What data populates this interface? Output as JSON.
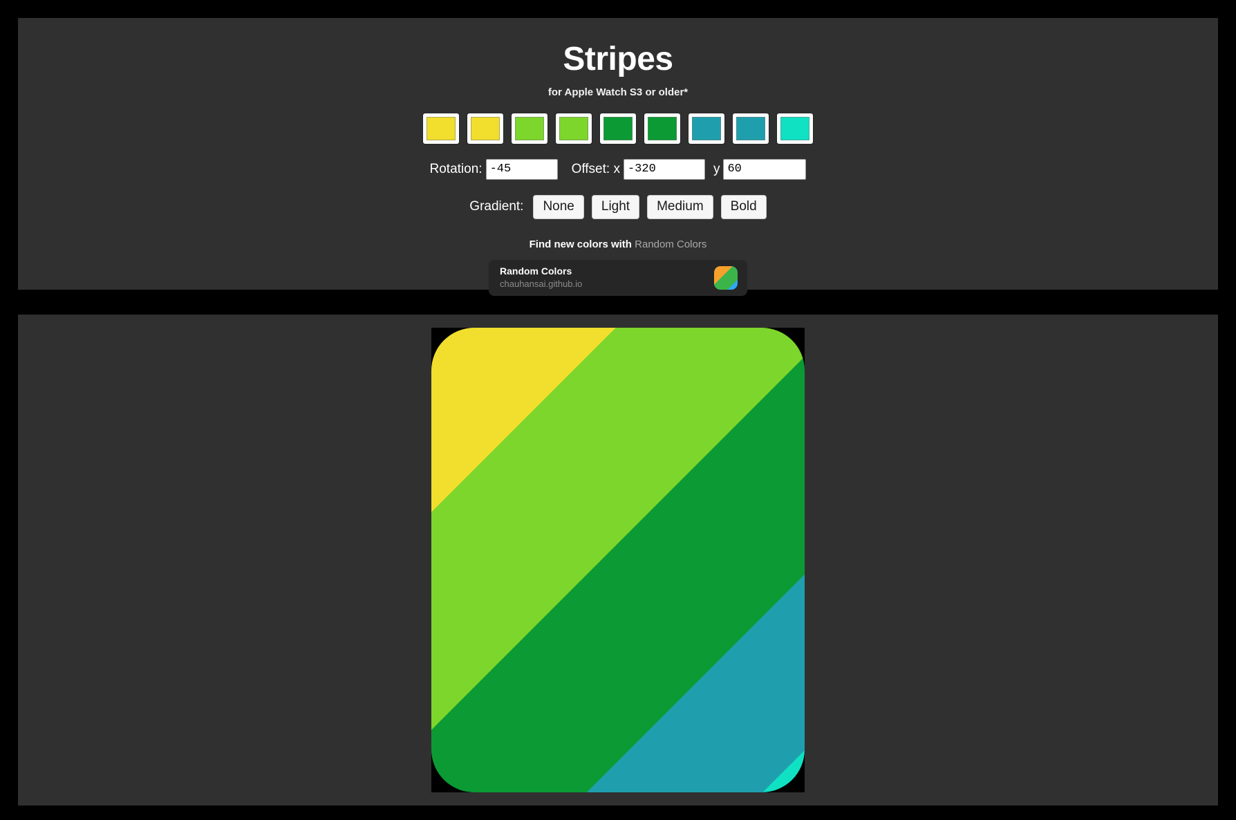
{
  "app": {
    "title": "Stripes",
    "subtitle": "for Apple Watch S3 or older*"
  },
  "palette": {
    "swatches": [
      {
        "name": "swatch-yellow-1",
        "color": "#F1DE2D"
      },
      {
        "name": "swatch-yellow-2",
        "color": "#F1DE2D"
      },
      {
        "name": "swatch-yellow-green-1",
        "color": "#7CD62B"
      },
      {
        "name": "swatch-yellow-green-2",
        "color": "#7CD62B"
      },
      {
        "name": "swatch-green-1",
        "color": "#0C9A34"
      },
      {
        "name": "swatch-green-2",
        "color": "#0C9A34"
      },
      {
        "name": "swatch-teal-1",
        "color": "#1F9FAD"
      },
      {
        "name": "swatch-teal-2",
        "color": "#1F9FAD"
      },
      {
        "name": "swatch-cyan-1",
        "color": "#10E1C3"
      }
    ]
  },
  "controls": {
    "rotation_label": "Rotation:",
    "rotation_value": "-45",
    "offset_label": "Offset: x",
    "offset_x_value": "-320",
    "offset_y_label": "y",
    "offset_y_value": "60",
    "gradient_label": "Gradient:",
    "gradient_options": [
      "None",
      "Light",
      "Medium",
      "Bold"
    ]
  },
  "promo": {
    "lead_text": "Find new colors with ",
    "link_text": "Random Colors",
    "card_title": "Random Colors",
    "card_url": "chauhansai.github.io",
    "card_icon": "random-colors-stripes-icon",
    "icon_colors": [
      "#E8315E",
      "#F7A02C",
      "#3BB54A",
      "#2FA8F5"
    ]
  },
  "preview": {
    "name": "stripes-preview",
    "rotation_deg": -45,
    "stops": [
      {
        "color": "#F1DE2D",
        "pos": 0
      },
      {
        "color": "#F1DE2D",
        "pos": 22
      },
      {
        "color": "#7CD62B",
        "pos": 22
      },
      {
        "color": "#7CD62B",
        "pos": 48
      },
      {
        "color": "#0C9A34",
        "pos": 48
      },
      {
        "color": "#0C9A34",
        "pos": 74
      },
      {
        "color": "#1F9FAD",
        "pos": 74
      },
      {
        "color": "#1F9FAD",
        "pos": 95
      },
      {
        "color": "#10E1C3",
        "pos": 95
      },
      {
        "color": "#10E1C3",
        "pos": 100
      }
    ]
  },
  "theme": {
    "page_bg": "#000000",
    "panel_bg": "#303030",
    "text": "#FFFFFF",
    "muted_text": "#A9A9A9",
    "card_bg": "#262626"
  }
}
